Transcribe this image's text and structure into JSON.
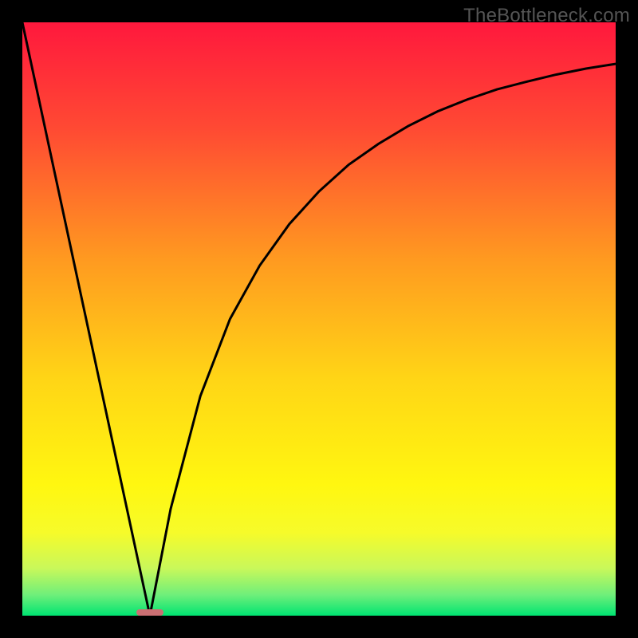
{
  "watermark": "TheBottleneck.com",
  "chart_data": {
    "type": "line",
    "title": "",
    "xlabel": "",
    "ylabel": "",
    "xlim": [
      0,
      100
    ],
    "ylim": [
      0,
      100
    ],
    "background_gradient": {
      "top_color": "#ff183d",
      "mid_colors": [
        "#ff7a2a",
        "#ffd516",
        "#fff710"
      ],
      "bottom_color": "#00e472"
    },
    "series": [
      {
        "name": "left-line",
        "x": [
          0,
          21.5
        ],
        "y": [
          100,
          0
        ]
      },
      {
        "name": "right-curve",
        "x": [
          21.5,
          25,
          30,
          35,
          40,
          45,
          50,
          55,
          60,
          65,
          70,
          75,
          80,
          85,
          90,
          95,
          100
        ],
        "y": [
          0,
          18,
          37,
          50,
          59,
          66,
          71.5,
          76,
          79.5,
          82.5,
          85,
          87,
          88.7,
          90,
          91.2,
          92.2,
          93
        ]
      }
    ],
    "marker": {
      "x_center": 21.5,
      "width_pct": 4.5,
      "y": 0,
      "color": "#cb6f73"
    },
    "grid": false,
    "legend": false
  }
}
